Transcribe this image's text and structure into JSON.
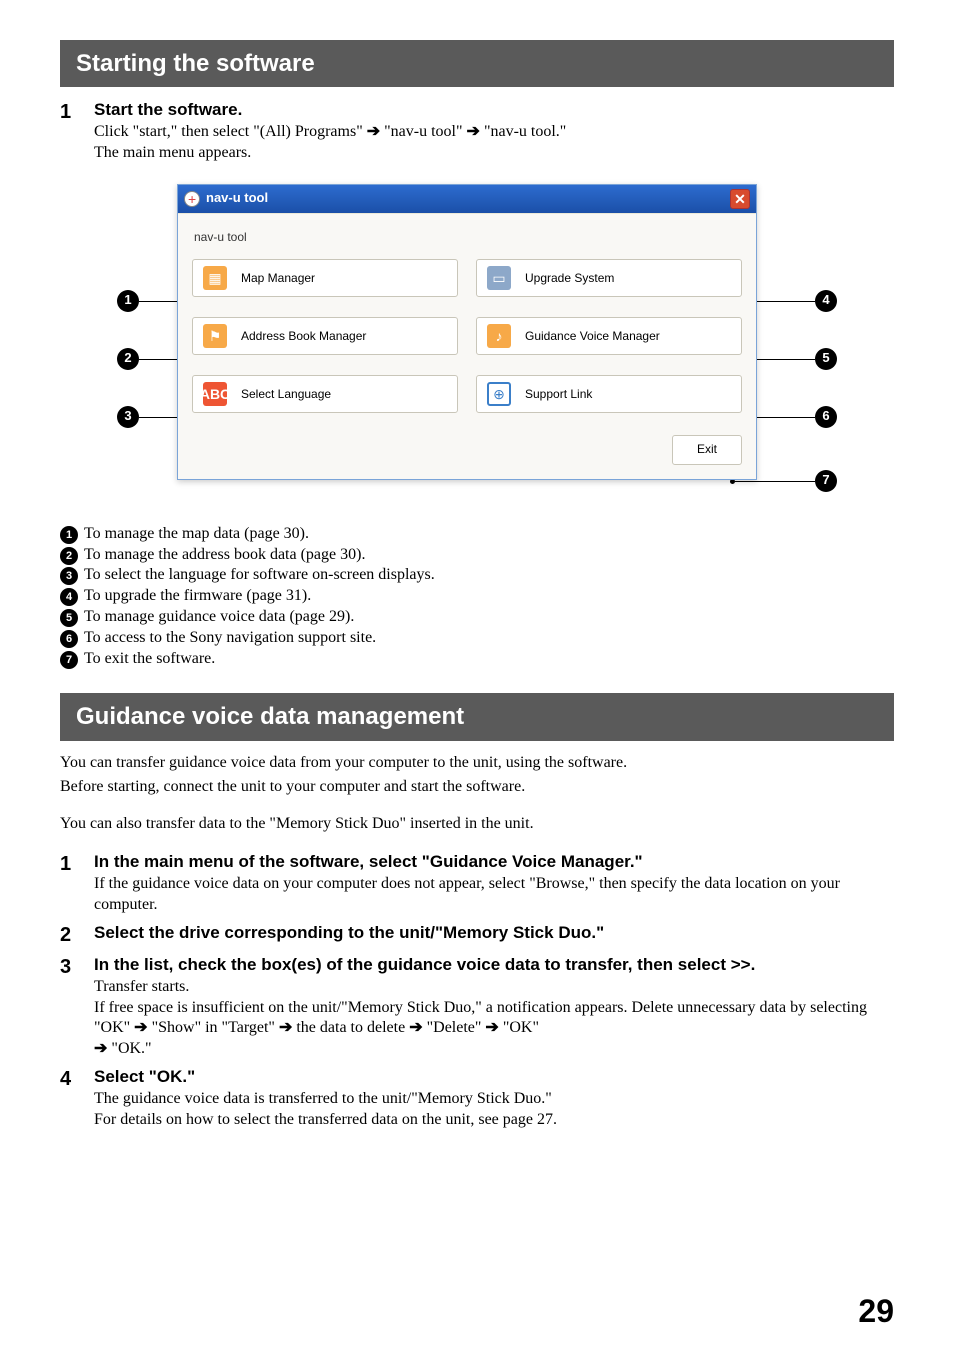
{
  "section1": {
    "title": "Starting the software",
    "step1": {
      "num": "1",
      "heading": "Start the software.",
      "line1a": "Click \"start,\" then select \"(All) Programs\" ",
      "line1b": " \"nav-u tool\" ",
      "line1c": " \"nav-u tool.\"",
      "line2": "The main menu appears."
    }
  },
  "screenshot": {
    "title": "nav-u tool",
    "sublabel": "nav-u tool",
    "close": "✕",
    "btn1": "Map Manager",
    "btn2": "Address Book Manager",
    "btn3": "Select Language",
    "btn4": "Upgrade System",
    "btn5": "Guidance Voice Manager",
    "btn6": "Support Link",
    "exit": "Exit",
    "ic_lang": "ABC"
  },
  "callouts": {
    "c1": "1",
    "c2": "2",
    "c3": "3",
    "c4": "4",
    "c5": "5",
    "c6": "6",
    "c7": "7"
  },
  "legend": {
    "l1": "To manage the map data (page 30).",
    "l2": "To manage the address book data (page 30).",
    "l3": "To select the language for software on-screen displays.",
    "l4": "To upgrade the firmware (page 31).",
    "l5": "To manage guidance voice data (page 29).",
    "l6": "To access to the Sony navigation support site.",
    "l7": "To exit the software."
  },
  "section2": {
    "title": "Guidance voice data management",
    "p1": "You can transfer guidance voice data from your computer to the unit, using the software.",
    "p2": "Before starting, connect the unit to your computer and start the software.",
    "p3": "You can also transfer data to the \"Memory Stick Duo\" inserted in the unit.",
    "s1": {
      "num": "1",
      "heading": "In the main menu of the software, select \"Guidance Voice Manager.\"",
      "text": "If the guidance voice data on your computer does not appear, select \"Browse,\" then specify the data location on your computer."
    },
    "s2": {
      "num": "2",
      "heading": "Select the drive corresponding to the unit/\"Memory Stick Duo.\""
    },
    "s3": {
      "num": "3",
      "heading": "In the list, check the box(es) of the guidance voice data to transfer, then select >>.",
      "text1": "Transfer starts.",
      "text2a": "If free space is insufficient on the unit/\"Memory Stick Duo,\" a notification appears. Delete unnecessary data by selecting \"OK\" ",
      "text2b": " \"Show\" in \"Target\" ",
      "text2c": " the data to delete ",
      "text2d": " \"Delete\" ",
      "text2e": " \"OK\" ",
      "text2f": " \"OK.\""
    },
    "s4": {
      "num": "4",
      "heading": "Select \"OK.\"",
      "text1": "The guidance voice data is transferred to the unit/\"Memory Stick Duo.\"",
      "text2": "For details on how to select the transferred data on the unit, see page 27."
    }
  },
  "pageNumber": "29"
}
